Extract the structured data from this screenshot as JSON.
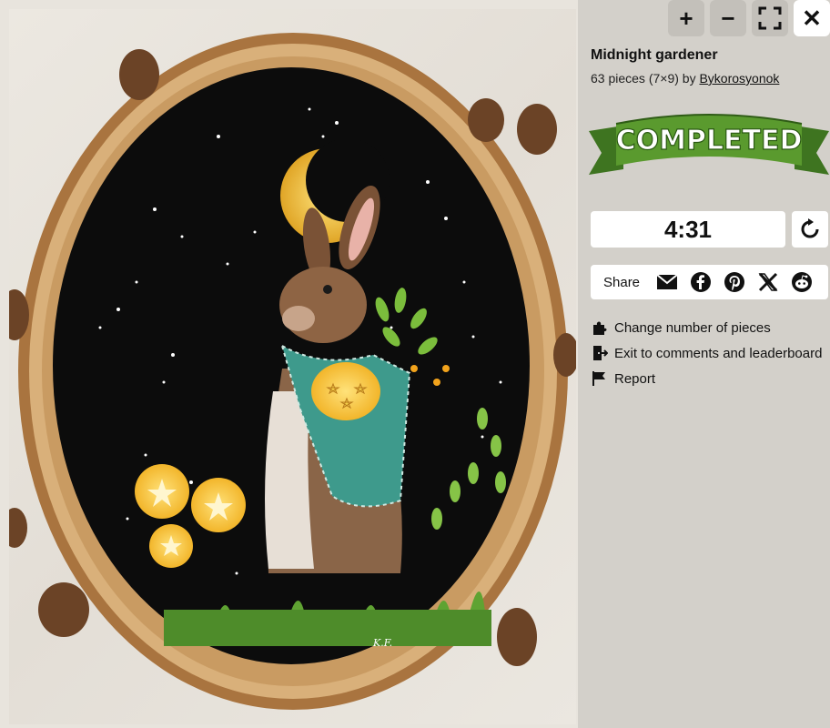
{
  "toolbar": {
    "zoom_in_label": "+",
    "zoom_out_label": "−",
    "close_label": "✕"
  },
  "puzzle": {
    "title": "Midnight gardener",
    "pieces_text": "63 pieces (7×9) by ",
    "author": "Bykorosyonok",
    "status": "COMPLETED",
    "timer": "4:31",
    "artist_signature": "K.F."
  },
  "share": {
    "label": "Share",
    "icons": [
      "email-icon",
      "facebook-icon",
      "pinterest-icon",
      "x-icon",
      "reddit-icon"
    ]
  },
  "menu": {
    "change_pieces": "Change number of pieces",
    "exit_comments": "Exit to comments and leaderboard",
    "report": "Report"
  },
  "colors": {
    "panel_bg": "#d3d0ca",
    "banner_green": "#5a9a2e",
    "banner_dark_green": "#3e7420",
    "painting_bg": "#0c0c0c",
    "wood_rim": "#b98656"
  }
}
